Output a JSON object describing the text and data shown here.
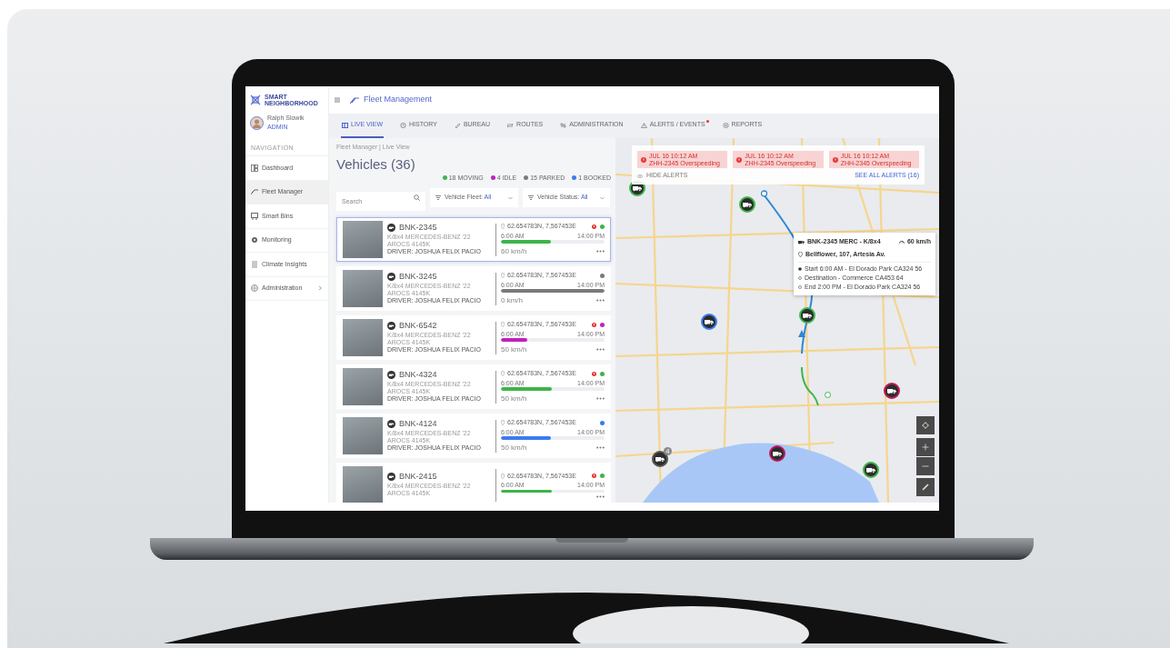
{
  "brand": {
    "name": "SMART NEIGHBORHOOD"
  },
  "user": {
    "name": "Ralph Slowik",
    "role": "ADMIN"
  },
  "sidebar": {
    "heading": "NAVIGATION",
    "items": [
      {
        "label": "Dashboard",
        "selected": false,
        "has_submenu": false
      },
      {
        "label": "Fleet Manager",
        "selected": true,
        "has_submenu": false
      },
      {
        "label": "Smart Bins",
        "selected": false,
        "has_submenu": false
      },
      {
        "label": "Monitoring",
        "selected": false,
        "has_submenu": false
      },
      {
        "label": "Climate Insights",
        "selected": false,
        "has_submenu": false
      },
      {
        "label": "Administration",
        "selected": false,
        "has_submenu": true
      }
    ]
  },
  "header": {
    "title": "Fleet Management"
  },
  "tabs": [
    {
      "label": "LIVE VIEW",
      "selected": true,
      "badge": false
    },
    {
      "label": "HISTORY",
      "selected": false,
      "badge": false
    },
    {
      "label": "BUREAU",
      "selected": false,
      "badge": false
    },
    {
      "label": "ROUTES",
      "selected": false,
      "badge": false
    },
    {
      "label": "ADMINISTRATION",
      "selected": false,
      "badge": false
    },
    {
      "label": "ALERTS / EVENTS",
      "selected": false,
      "badge": true
    },
    {
      "label": "REPORTS",
      "selected": false,
      "badge": false
    }
  ],
  "breadcrumb": "Fleet Manager | Live View",
  "page_title": "Vehicles (36)",
  "legend": [
    {
      "label": "18 MOVING",
      "color": "#3cb54a"
    },
    {
      "label": "4 IDLE",
      "color": "#c21fc0"
    },
    {
      "label": "15 PARKED",
      "color": "#7a7a7a"
    },
    {
      "label": "1 BOOKED",
      "color": "#3b7bf0"
    }
  ],
  "search": {
    "placeholder": "Search"
  },
  "filters": [
    {
      "label": "Vehicle Fleet:",
      "value": "All"
    },
    {
      "label": "Vehicle Status:",
      "value": "All"
    }
  ],
  "vehicles": [
    {
      "plate": "BNK-2345",
      "model": "K/8x4 MERCEDES-BENZ '22 AROCS 4145K",
      "driver": "DRIVER: JOSHUA FELIX PACIO",
      "coords": "62.654783N, 7,567453E",
      "start": "6:00 AM",
      "end": "14:00 PM",
      "level": 0.48,
      "color": "#3cb54a",
      "speed": "60 km/h",
      "alert": true,
      "selected": true
    },
    {
      "plate": "BNK-3245",
      "model": "K/8x4 MERCEDES-BENZ '22 AROCS 4145K",
      "driver": "DRIVER: JOSHUA FELIX PACIO",
      "coords": "62.654783N, 7,567453E",
      "start": "6:00 AM",
      "end": "14:00 PM",
      "level": 1.0,
      "color": "#7a7a7a",
      "speed": "0 km/h",
      "alert": false,
      "selected": false
    },
    {
      "plate": "BNK-6542",
      "model": "K/8x4 MERCEDES-BENZ '22 AROCS 4145K",
      "driver": "DRIVER: JOSHUA FELIX PACIO",
      "coords": "62.654783N, 7,567453E",
      "start": "6:00 AM",
      "end": "14:00 PM",
      "level": 0.25,
      "color": "#c21fc0",
      "speed": "50 km/h",
      "alert": true,
      "selected": false
    },
    {
      "plate": "BNK-4324",
      "model": "K/8x4 MERCEDES-BENZ '22 AROCS 4145K",
      "driver": "DRIVER: JOSHUA FELIX PACIO",
      "coords": "62.654783N, 7,567453E",
      "start": "6:00 AM",
      "end": "14:00 PM",
      "level": 0.49,
      "color": "#3cb54a",
      "speed": "50 km/h",
      "alert": true,
      "selected": false
    },
    {
      "plate": "BNK-4124",
      "model": "K/8x4 MERCEDES-BENZ '22 AROCS 4145K",
      "driver": "DRIVER: JOSHUA FELIX PACIO",
      "coords": "62.654783N, 7,567453E",
      "start": "6:00 AM",
      "end": "14:00 PM",
      "level": 0.48,
      "color": "#3b7bf0",
      "speed": "50 km/h",
      "alert": false,
      "selected": false
    },
    {
      "plate": "BNK-2415",
      "model": "K/8x4 MERCEDES-BENZ '22 AROCS 4145K",
      "start": "6:00 AM",
      "end": "14:00 PM",
      "coords": "62.654783N, 7,567453E",
      "level": 0.49,
      "color": "#3cb54a",
      "alert": true,
      "selected": false
    }
  ],
  "map": {
    "alerts": [
      {
        "time": "JUL 16 10:12 AM",
        "text": "ZHH-2345 Overspeeding"
      },
      {
        "time": "JUL 16 10:12 AM",
        "text": "ZHH-2345 Overspeeding"
      },
      {
        "time": "JUL 16 10:12 AM",
        "text": "ZHH-2345 Overspeeding"
      }
    ],
    "hide_label": "HIDE ALERTS",
    "see_all": "SEE ALL ALERTS (16)",
    "markers": [
      {
        "color": "#3cb54a"
      },
      {
        "color": "#3cb54a"
      },
      {
        "color": "#3b7bf0"
      },
      {
        "color": "#3cb54a"
      },
      {
        "color": "#c2185b"
      },
      {
        "color": "#555555",
        "count": "4"
      },
      {
        "color": "#c2185b"
      },
      {
        "color": "#3cb54a"
      }
    ],
    "popup": {
      "title": "BNK-2345 MERC - K/8x4",
      "speed": "60 km/h",
      "address": "Bellflower, 107, Artesia Av.",
      "stops": [
        {
          "text": "Start 6:00 AM - El Dorado Park CA324 56",
          "reached": true
        },
        {
          "text": "Destination - Commerce CA453 64",
          "reached": false
        },
        {
          "text": "End 2:00 PM - El Dorado Park CA324 56",
          "reached": false
        }
      ]
    }
  }
}
